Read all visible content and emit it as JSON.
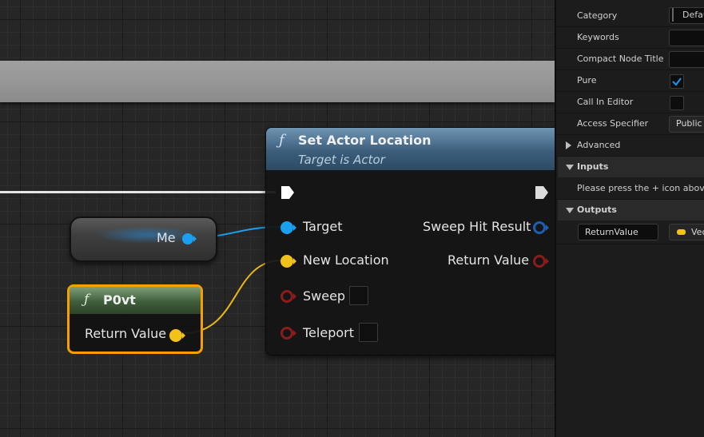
{
  "graph": {
    "set_actor_location": {
      "title": "Set Actor Location",
      "subtitle": "Target is Actor",
      "inputs": [
        "Target",
        "New Location",
        "Sweep",
        "Teleport"
      ],
      "outputs": [
        "Sweep Hit Result",
        "Return Value"
      ]
    },
    "self_node": {
      "label": "Me"
    },
    "pvt_node": {
      "title": "P0vt",
      "output": "Return Value"
    },
    "function_icon": "ƒ",
    "colors": {
      "object_pin": "#1aa0f0",
      "vector_pin": "#f2c21a",
      "bool_pin": "#8b1c1c",
      "struct_pin": "#1c5fb0",
      "selected_outline": "#f5a000"
    }
  },
  "details": {
    "rows": [
      {
        "label": "Category",
        "value": "Defau"
      },
      {
        "label": "Keywords",
        "value": ""
      },
      {
        "label": "Compact Node Title",
        "value": ""
      },
      {
        "label": "Pure",
        "checked": true
      },
      {
        "label": "Call In Editor",
        "checked": false
      },
      {
        "label": "Access Specifier",
        "value": "Public"
      }
    ],
    "advanced_label": "Advanced",
    "inputs_label": "Inputs",
    "inputs_hint": "Please press the + icon above to",
    "outputs_label": "Outputs",
    "output_param": {
      "name": "ReturnValue",
      "type": "Vec"
    }
  }
}
